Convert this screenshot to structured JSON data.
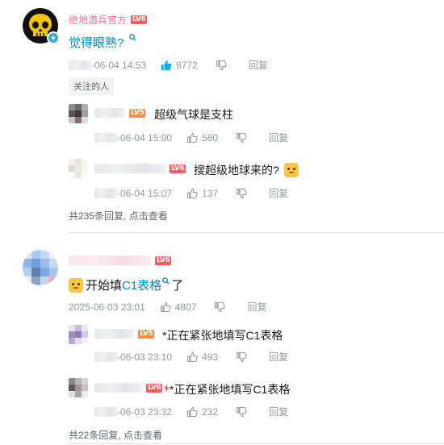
{
  "colors": {
    "accent_blue": "#008ac5",
    "level6": "#ff5b5b",
    "level5": "#ff8a3d",
    "meta_gray": "#9499a0"
  },
  "icons": [
    "skull-avatar-icon",
    "verified-badge-icon",
    "search-icon",
    "thumb-up-icon",
    "thumb-down-icon",
    "sticker-emoji-icon"
  ],
  "thread1": {
    "author": "绝地潜兵官方",
    "level": "LV6",
    "content": "觉得眼熟?",
    "time": "-06-04 14:53",
    "likes": "8772",
    "reply_label": "回复",
    "tag": "关注的人",
    "replies": [
      {
        "level": "LV5",
        "content": "超级气球是支柱",
        "time": "-06-04 15:00",
        "likes": "580",
        "reply_label": "回复"
      },
      {
        "level": "LV6",
        "content": "搜超级地球来的?",
        "time": "-06-04 15:07",
        "likes": "137",
        "reply_label": "回复"
      }
    ],
    "more": "共235条回复, 点击查看"
  },
  "thread2": {
    "level": "LV6",
    "content_pre": "开始填",
    "content_link": "C1表格",
    "content_post": "了",
    "time": "2025-06-03 23:01",
    "likes": "4807",
    "reply_label": "回复",
    "replies": [
      {
        "level": "LV5",
        "content": "*正在紧张地填写C1表格",
        "time": "-06-03 23:10",
        "likes": "493",
        "reply_label": "回复"
      },
      {
        "level": "LV6",
        "content": "*正在紧张地填写C1表格",
        "time": "-06-03 23:32",
        "likes": "232",
        "reply_label": "回复"
      }
    ],
    "more": "共22条回复, 点击查看"
  }
}
